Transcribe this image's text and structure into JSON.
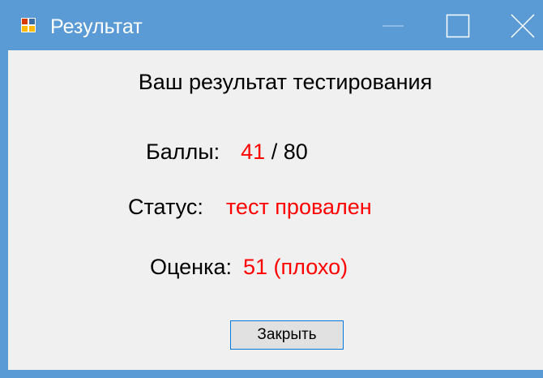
{
  "window": {
    "title": "Результат",
    "icon": "app-window-icon",
    "controls": [
      "minimize-icon",
      "maximize-icon",
      "close-icon"
    ],
    "accent_color": "#5b9bd5"
  },
  "content": {
    "heading": "Ваш результат тестирования",
    "score": {
      "label": "Баллы:",
      "value": "41",
      "separator_total": " / 80"
    },
    "status": {
      "label": "Статус:",
      "value": "тест провален"
    },
    "grade": {
      "label": "Оценка:",
      "value": "51 (плохо)"
    },
    "close_button_label": "Закрыть",
    "highlight_color": "#ff0000"
  }
}
